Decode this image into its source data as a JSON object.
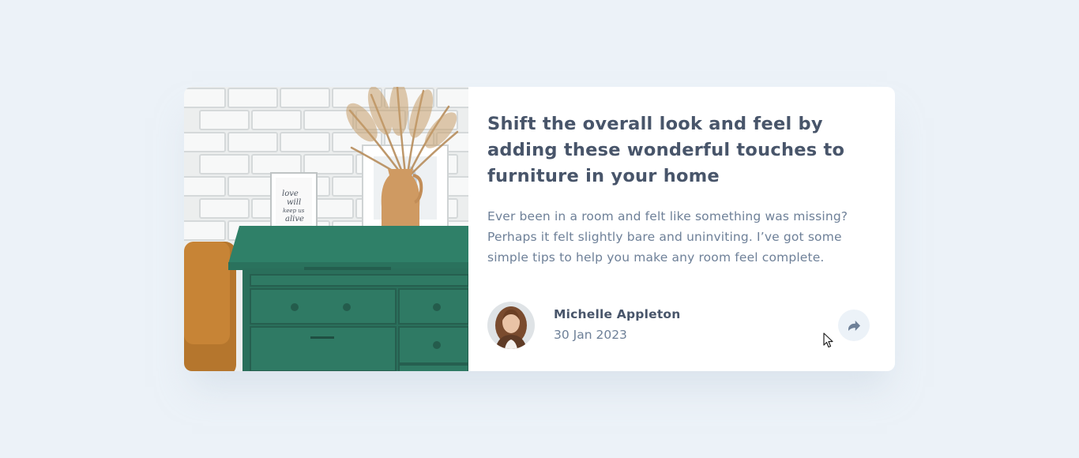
{
  "article": {
    "title": "Shift the overall look and feel by adding these wonderful touches to furniture in your home",
    "excerpt": "Ever been in a room and felt like something was missing? Perhaps it felt slightly bare and uninviting. I’ve got some simple tips to help you make any room feel complete."
  },
  "frame_text": [
    "love",
    "will",
    "keep us",
    "alive"
  ],
  "author": {
    "name": "Michelle Appleton",
    "date": "30 Jan 2023"
  },
  "share": {
    "icon": "share-icon"
  },
  "colors": {
    "background": "#ecf2f8",
    "title": "#48556a",
    "body": "#6e8098",
    "dresser": "#2f7a64"
  }
}
